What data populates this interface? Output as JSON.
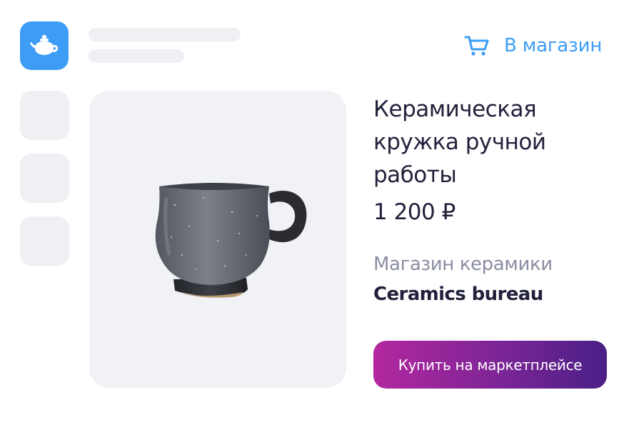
{
  "header": {
    "logo_icon": "teapot-icon",
    "shop_link": {
      "icon": "cart-icon",
      "label": "В магазин"
    }
  },
  "product": {
    "title": "Керамическая кружка ручной работы",
    "price": "1 200 ₽",
    "seller_label": "Магазин керамики",
    "seller_name": "Ceramics bureau",
    "image": "ceramic-mug-image"
  },
  "actions": {
    "buy_label": "Купить на маркетплейсе"
  },
  "colors": {
    "accent": "#3d9cf5",
    "text": "#21213b",
    "muted": "#8a8da2",
    "placeholder": "#eef0f4",
    "button_gradient": [
      "#b3279f",
      "#4a1f86"
    ]
  }
}
